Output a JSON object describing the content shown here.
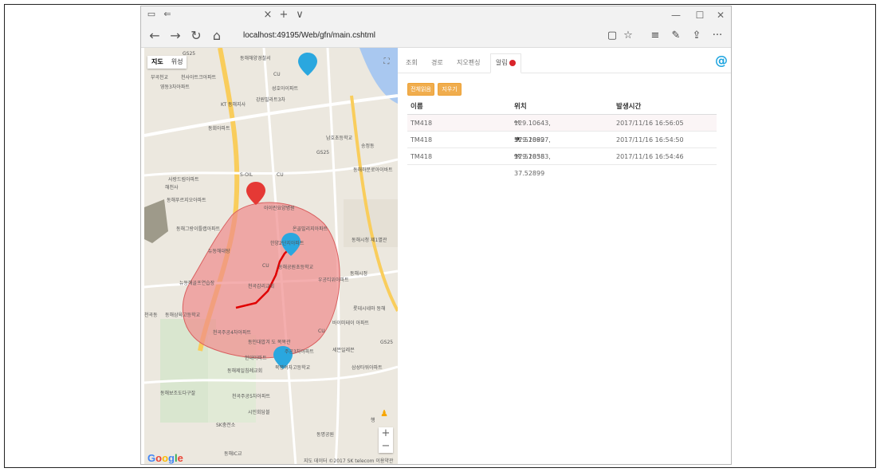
{
  "browser": {
    "address": "localhost:49195/Web/gfn/main.cshtml",
    "new_tab": "+",
    "tab_list": "∨",
    "close_tab": "×",
    "more": "···"
  },
  "map": {
    "type_map": "지도",
    "type_satellite": "위성",
    "google": "Google",
    "attribution": "지도 데이터 ©2017 SK telecom   이용약관",
    "zoom_in": "+",
    "zoom_out": "−",
    "labels": [
      "GS25",
      "동해해양경찰서",
      "부곡천교",
      "천사아트크아파트",
      "CU",
      "영동3차아파트",
      "성호아이파트",
      "KT 동해지사",
      "강원빌라트3차",
      "동회아파트",
      "남호초등학교",
      "GS25",
      "송정동",
      "동해하문로아이바트",
      "사랑드림아파트",
      "해천사",
      "S-OIL",
      "CU",
      "동해푸르지오아파트",
      "아이린요양병원",
      "동해그랑이틀랩아파트",
      "온골빌리지아파트",
      "동해시청 제1별관",
      "뉴동해대탕",
      "한양2단지아파트",
      "CU",
      "동해시정",
      "동해공원초등학교",
      "뉴동해골프연습장",
      "천곡감리교회",
      "우공티위아파트",
      "롯데시네마 동해",
      "천곡동",
      "동해삼육고등학교",
      "바이미테이 아파트",
      "천곡주공4차아파트",
      "CU",
      "GS25",
      "동인대밥겨 도 복목관",
      "세븐일레븐",
      "주공3차아파트",
      "현대아파트",
      "동해제일침례교회",
      "북평여자고등학교",
      "삼성타워아파트",
      "동해보조도다구잘",
      "천곡주공5차아파트",
      "시민회담블",
      "SK충전소",
      "동명공원",
      "동해IC교",
      "행"
    ]
  },
  "panel": {
    "tabs": [
      "조회",
      "경로",
      "지오펜싱",
      "알림"
    ],
    "btn_select_all": "전체읽음",
    "btn_delete": "지우기",
    "columns": {
      "name": "이름",
      "location": "위치",
      "time": "발생시간"
    },
    "rows": [
      {
        "name": "TM418",
        "location": "129.10643, 37.52899",
        "time": "2017/11/16 16:56:05",
        "direction": "exit"
      },
      {
        "name": "TM418",
        "location": "129.10827, 37.52838",
        "time": "2017/11/16 16:54:50",
        "direction": "enter"
      },
      {
        "name": "TM418",
        "location": "129.10583, 37.52899",
        "time": "2017/11/16 16:54:46",
        "direction": "exit"
      }
    ],
    "at_icon": "@"
  },
  "colors": {
    "accent": "#1fa5e0",
    "button": "#f0ad4e",
    "alarm": "#d9242b",
    "geofence": "#f08c8c",
    "marker_red": "#e53935"
  }
}
